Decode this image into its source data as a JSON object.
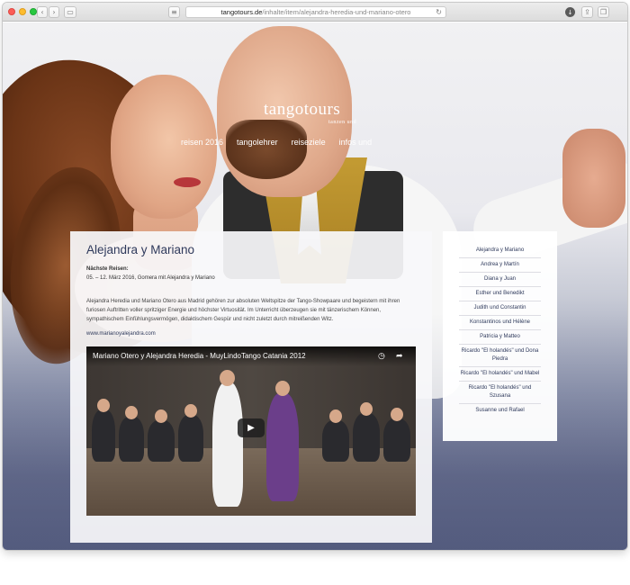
{
  "browser": {
    "url_domain": "tangotours.de",
    "url_path": "/inhalte/item/alejandra-heredia-und-mariano-otero"
  },
  "site": {
    "brand": "tangotours",
    "brand_sub": "tanzen und",
    "nav": [
      "reisen 2016",
      "tangolehrer",
      "reiseziele",
      "infos und"
    ]
  },
  "article": {
    "title": "Alejandra y Mariano",
    "next_label": "Nächste Reisen:",
    "next_date": "05. – 12. März 2016, Gomera mit Alejandra y Mariano",
    "description": "Alejandra Heredia und Mariano Otero aus Madrid gehören zur absoluten Weltspitze der Tango-Showpaare und begeistern mit ihren furiosen Auftritten voller spritziger Energie und höchster Virtuosität. Im Unterricht überzeugen sie mit tänzerischem Können, sympathischem Einfühlungsvermögen, didaktischem Gespür und nicht zuletzt durch mitreißenden Witz.",
    "link": "www.marianoyalejandra.com"
  },
  "video": {
    "title": "Mariano Otero y Alejandra Heredia - MuyLindoTango Catania 2012",
    "watch_later_icon": "clock-icon",
    "share_icon": "share-icon",
    "play_icon": "play-icon"
  },
  "sidebar": {
    "items": [
      "Alejandra y Mariano",
      "Andrea y Martín",
      "Diana y Juan",
      "Esther und Benedikt",
      "Judith und Constantin",
      "Konstantinos und Hélène",
      "Patricia y Matteo",
      "Ricardo \"El holandés\" und Dona Piedra",
      "Ricardo \"El holandés\" und Mabel",
      "Ricardo \"El holandés\" und Szusana",
      "Susanne und Rafael"
    ]
  },
  "colors": {
    "heading": "#2f3a5c",
    "accent_link": "#2f3a5c"
  }
}
